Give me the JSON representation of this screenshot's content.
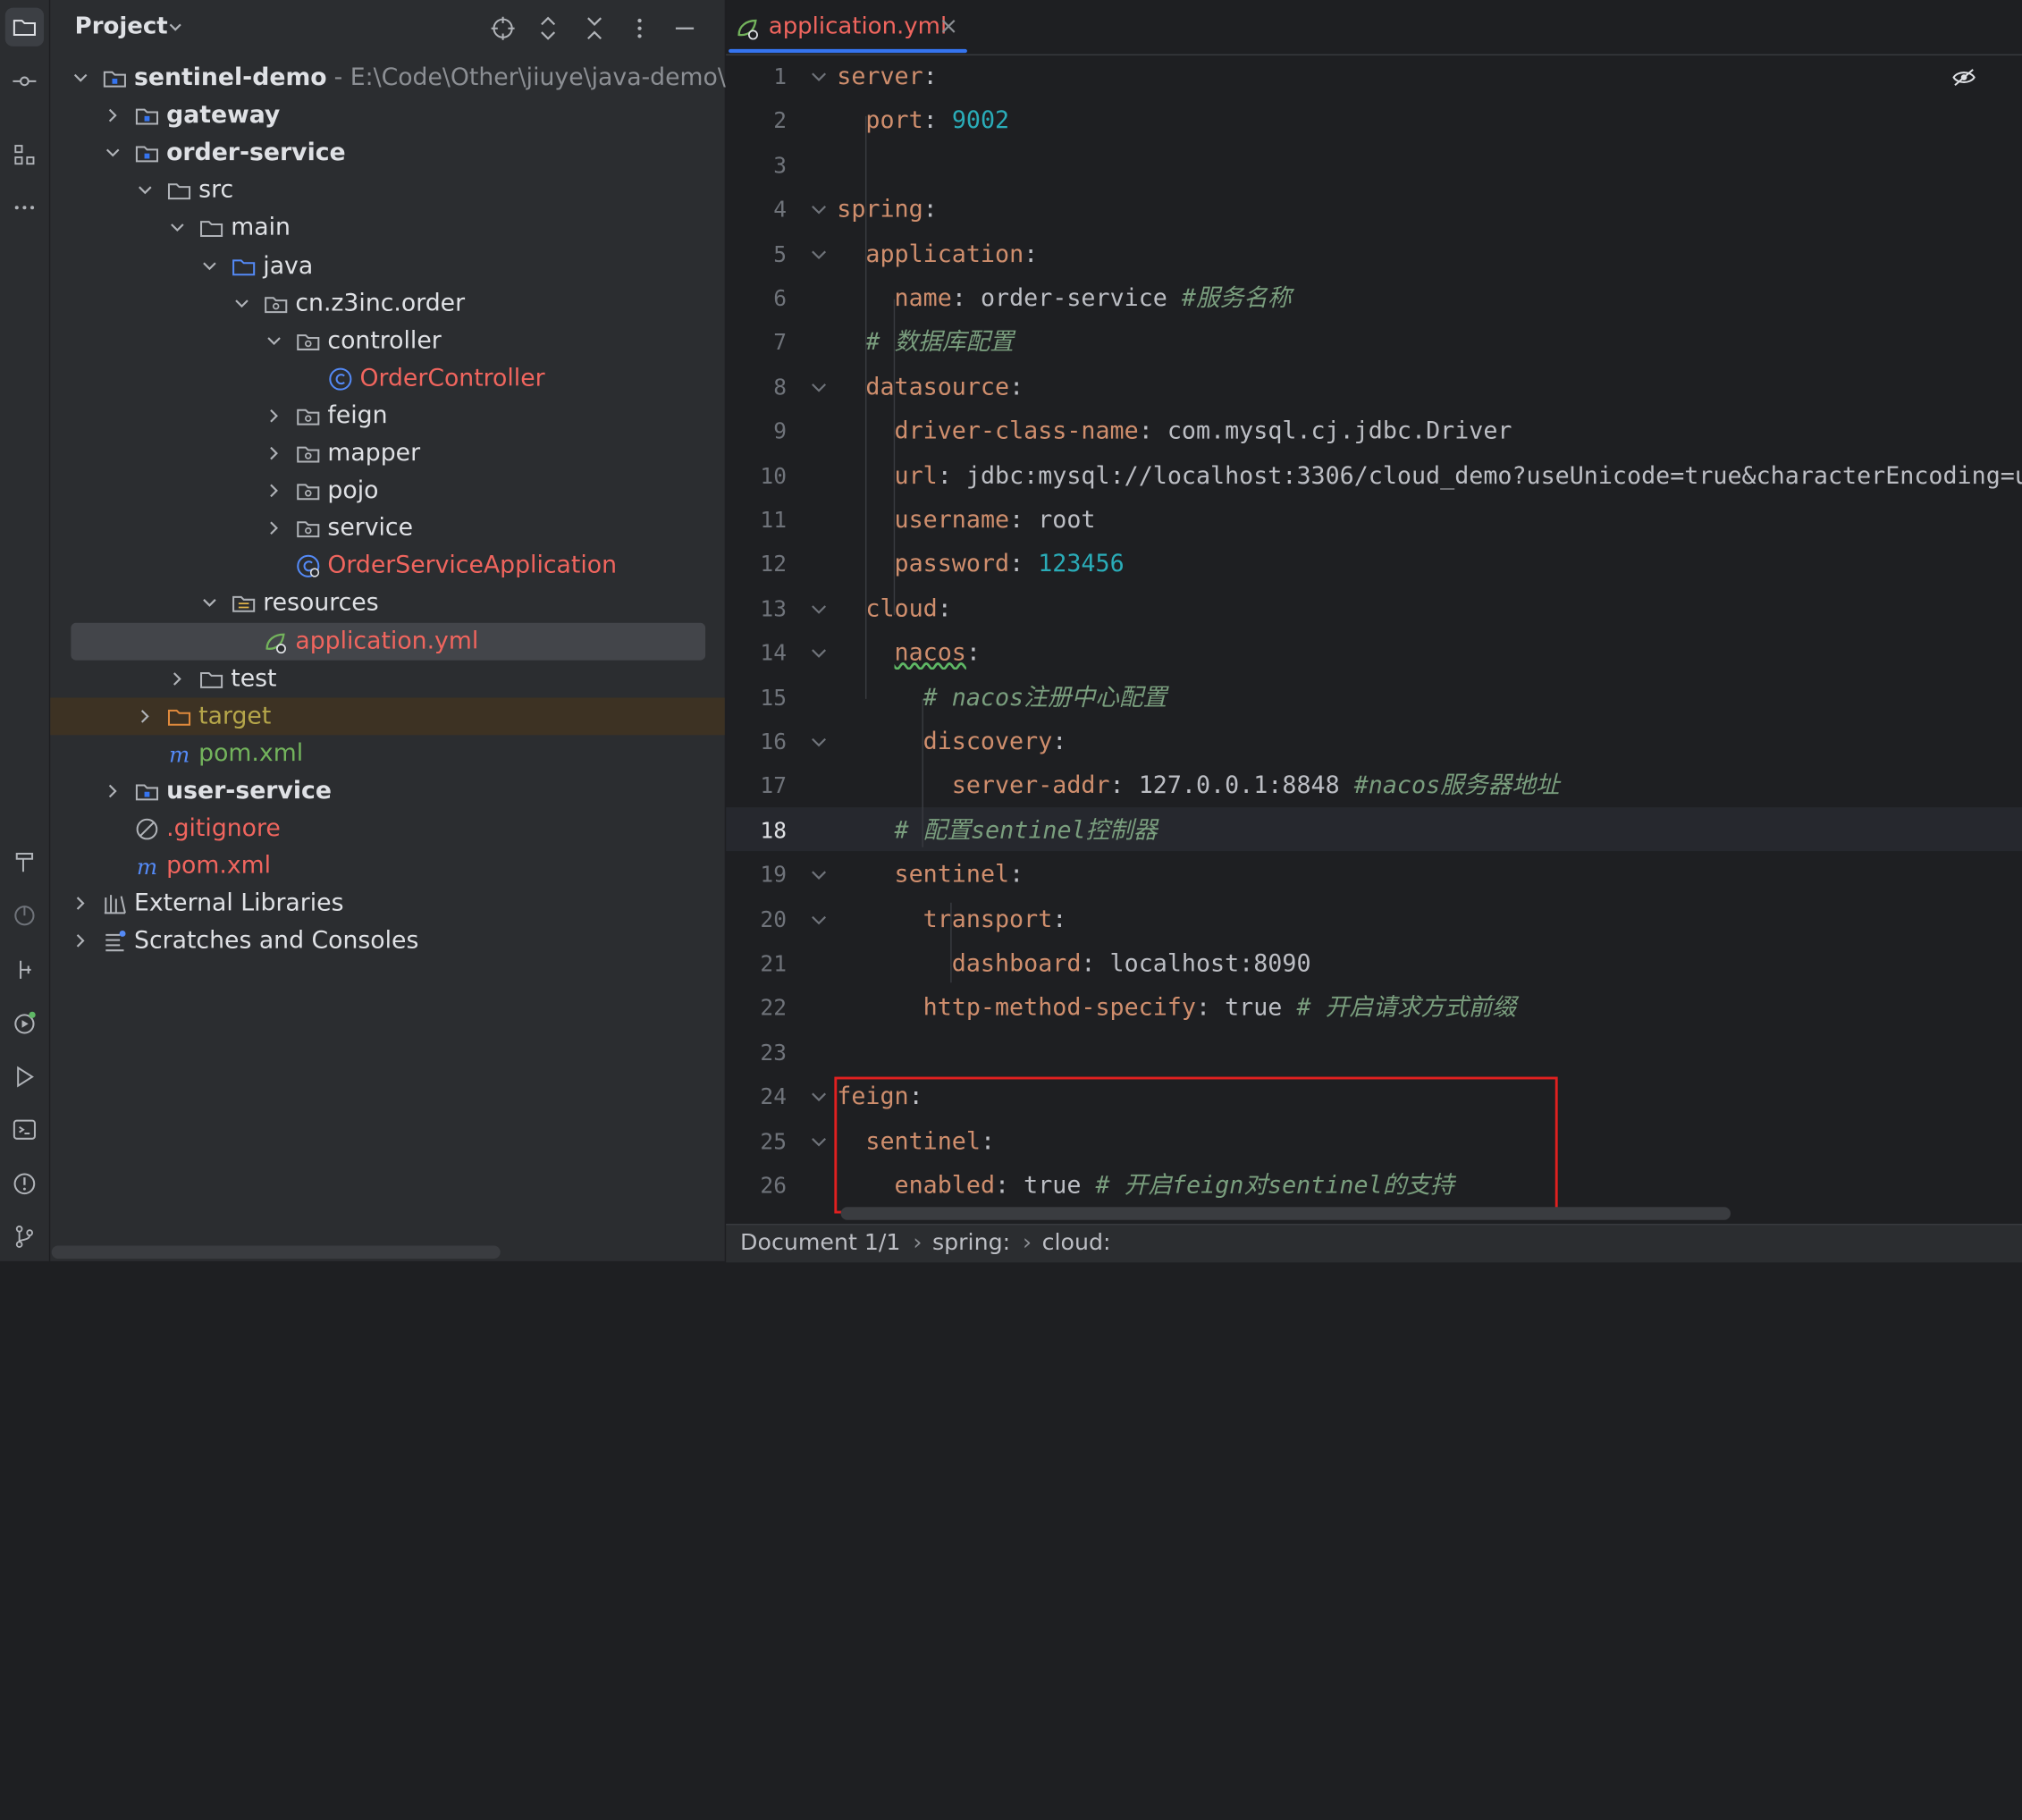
{
  "project_panel": {
    "title": "Project",
    "tree": [
      {
        "label": "sentinel-demo",
        "hint": "- E:\\Code\\Other\\jiuye\\java-demo\\s"
      },
      {
        "label": "gateway"
      },
      {
        "label": "order-service"
      },
      {
        "label": "src"
      },
      {
        "label": "main"
      },
      {
        "label": "java"
      },
      {
        "label": "cn.z3inc.order"
      },
      {
        "label": "controller"
      },
      {
        "label": "OrderController"
      },
      {
        "label": "feign"
      },
      {
        "label": "mapper"
      },
      {
        "label": "pojo"
      },
      {
        "label": "service"
      },
      {
        "label": "OrderServiceApplication"
      },
      {
        "label": "resources"
      },
      {
        "label": "application.yml"
      },
      {
        "label": "test"
      },
      {
        "label": "target"
      },
      {
        "label": "pom.xml"
      },
      {
        "label": "user-service"
      },
      {
        "label": ".gitignore"
      },
      {
        "label": "pom.xml"
      },
      {
        "label": "External Libraries"
      },
      {
        "label": "Scratches and Consoles"
      }
    ]
  },
  "editor": {
    "tab": {
      "label": "application.yml",
      "close": "×"
    },
    "current_line": 18,
    "lines": [
      {
        "no": "1",
        "indent": "",
        "key": "server",
        "sep": ":",
        "val": "",
        "comment": ""
      },
      {
        "no": "2",
        "indent": "  ",
        "key": "port",
        "sep": ": ",
        "val": "9002",
        "comment": ""
      },
      {
        "no": "3",
        "indent": "",
        "key": "",
        "sep": "",
        "val": "",
        "comment": ""
      },
      {
        "no": "4",
        "indent": "",
        "key": "spring",
        "sep": ":",
        "val": "",
        "comment": ""
      },
      {
        "no": "5",
        "indent": "  ",
        "key": "application",
        "sep": ":",
        "val": "",
        "comment": ""
      },
      {
        "no": "6",
        "indent": "    ",
        "key": "name",
        "sep": ": ",
        "val": "order-service ",
        "comment": "#服务名称"
      },
      {
        "no": "7",
        "indent": "  ",
        "key": "",
        "sep": "",
        "val": "",
        "comment": "# 数据库配置"
      },
      {
        "no": "8",
        "indent": "  ",
        "key": "datasource",
        "sep": ":",
        "val": "",
        "comment": ""
      },
      {
        "no": "9",
        "indent": "    ",
        "key": "driver-class-name",
        "sep": ": ",
        "val": "com.mysql.cj.jdbc.Driver",
        "comment": ""
      },
      {
        "no": "10",
        "indent": "    ",
        "key": "url",
        "sep": ": ",
        "val": "jdbc:mysql://localhost:3306/cloud_demo?useUnicode=true&characterEncoding=u",
        "comment": ""
      },
      {
        "no": "11",
        "indent": "    ",
        "key": "username",
        "sep": ": ",
        "val": "root",
        "comment": ""
      },
      {
        "no": "12",
        "indent": "    ",
        "key": "password",
        "sep": ": ",
        "val": "123456",
        "comment": ""
      },
      {
        "no": "13",
        "indent": "  ",
        "key": "cloud",
        "sep": ":",
        "val": "",
        "comment": ""
      },
      {
        "no": "14",
        "indent": "    ",
        "key": "nacos",
        "sep": ":",
        "val": "",
        "comment": ""
      },
      {
        "no": "15",
        "indent": "      ",
        "key": "",
        "sep": "",
        "val": "",
        "comment": "# nacos注册中心配置"
      },
      {
        "no": "16",
        "indent": "      ",
        "key": "discovery",
        "sep": ":",
        "val": "",
        "comment": ""
      },
      {
        "no": "17",
        "indent": "        ",
        "key": "server-addr",
        "sep": ": ",
        "val": "127.0.0.1:8848 ",
        "comment": "#nacos服务器地址"
      },
      {
        "no": "18",
        "indent": "    ",
        "key": "",
        "sep": "",
        "val": "",
        "comment": "# 配置sentinel控制器"
      },
      {
        "no": "19",
        "indent": "    ",
        "key": "sentinel",
        "sep": ":",
        "val": "",
        "comment": ""
      },
      {
        "no": "20",
        "indent": "      ",
        "key": "transport",
        "sep": ":",
        "val": "",
        "comment": ""
      },
      {
        "no": "21",
        "indent": "        ",
        "key": "dashboard",
        "sep": ": ",
        "val": "localhost:8090",
        "comment": ""
      },
      {
        "no": "22",
        "indent": "      ",
        "key": "http-method-specify",
        "sep": ": ",
        "val": "true ",
        "comment": "# 开启请求方式前缀"
      },
      {
        "no": "23",
        "indent": "",
        "key": "",
        "sep": "",
        "val": "",
        "comment": ""
      },
      {
        "no": "24",
        "indent": "",
        "key": "feign",
        "sep": ":",
        "val": "",
        "comment": ""
      },
      {
        "no": "25",
        "indent": "  ",
        "key": "sentinel",
        "sep": ":",
        "val": "",
        "comment": ""
      },
      {
        "no": "26",
        "indent": "    ",
        "key": "enabled",
        "sep": ": ",
        "val": "true ",
        "comment": "# 开启feign对sentinel的支持"
      }
    ]
  },
  "statusbar": {
    "crumbs": [
      "Document 1/1",
      "spring:",
      "cloud:"
    ],
    "sep": "›"
  },
  "colors": {
    "accent": "#3574f0",
    "highlight_box": "#e02020",
    "yaml_key": "#cf8e6d",
    "number": "#2aacb8",
    "comment": "#7a9e7e"
  }
}
